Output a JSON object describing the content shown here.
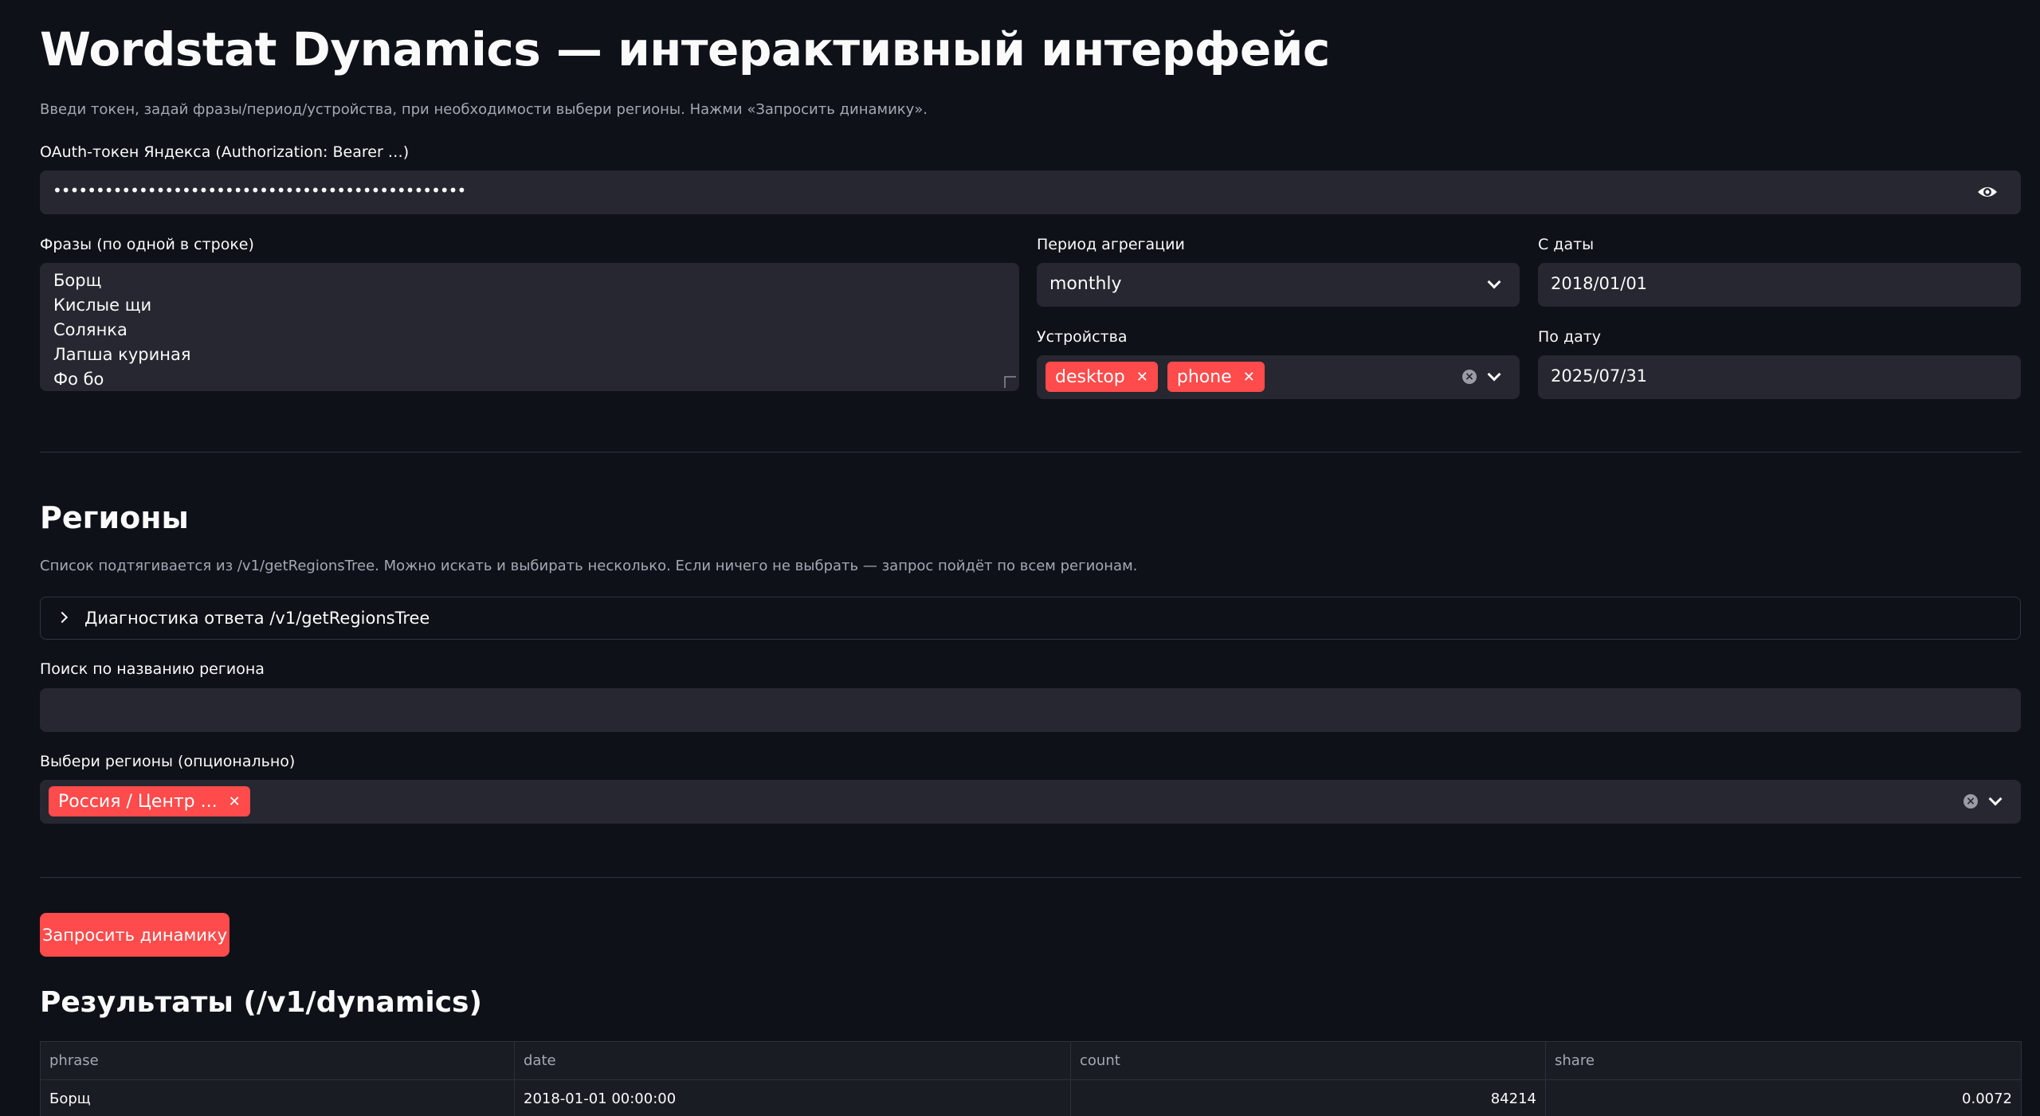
{
  "page": {
    "title": "Wordstat Dynamics — интерактивный интерфейс",
    "subtitle": "Введи токен, задай фразы/период/устройства, при необходимости выбери регионы. Нажми «Запросить динамику»."
  },
  "token": {
    "label": "OAuth-токен Яндекса (Authorization: Bearer …)",
    "value": "••••••••••••••••••••••••••••••••••••••••••••••••"
  },
  "phrases": {
    "label": "Фразы (по одной в строке)",
    "lines": [
      "Борщ",
      "Кислые щи",
      "Солянка",
      "Лапша куриная",
      "Фо бо"
    ]
  },
  "period": {
    "label": "Период агрегации",
    "value": "monthly"
  },
  "devices": {
    "label": "Устройства",
    "tags": [
      "desktop",
      "phone"
    ]
  },
  "date_from": {
    "label": "С даты",
    "value": "2018/01/01"
  },
  "date_to": {
    "label": "По дату",
    "value": "2025/07/31"
  },
  "regions": {
    "heading": "Регионы",
    "caption": "Список подтягивается из /v1/getRegionsTree. Можно искать и выбирать несколько. Если ничего не выбрать — запрос пойдёт по всем регионам.",
    "diagnostics_label": "Диагностика ответа /v1/getRegionsTree",
    "search_label": "Поиск по названию региона",
    "search_value": "",
    "select_label": "Выбери регионы (опционально)",
    "selected_tags": [
      "Россия / Центр ..."
    ]
  },
  "submit": {
    "label": "Запросить динамику"
  },
  "results": {
    "heading": "Результаты (/v1/dynamics)",
    "columns": [
      "phrase",
      "date",
      "count",
      "share"
    ],
    "rows": [
      [
        "Борщ",
        "2018-01-01 00:00:00",
        "84214",
        "0.0072"
      ]
    ]
  },
  "colors": {
    "background": "#0e1117",
    "field": "#262730",
    "accent": "#ff4b4b"
  }
}
